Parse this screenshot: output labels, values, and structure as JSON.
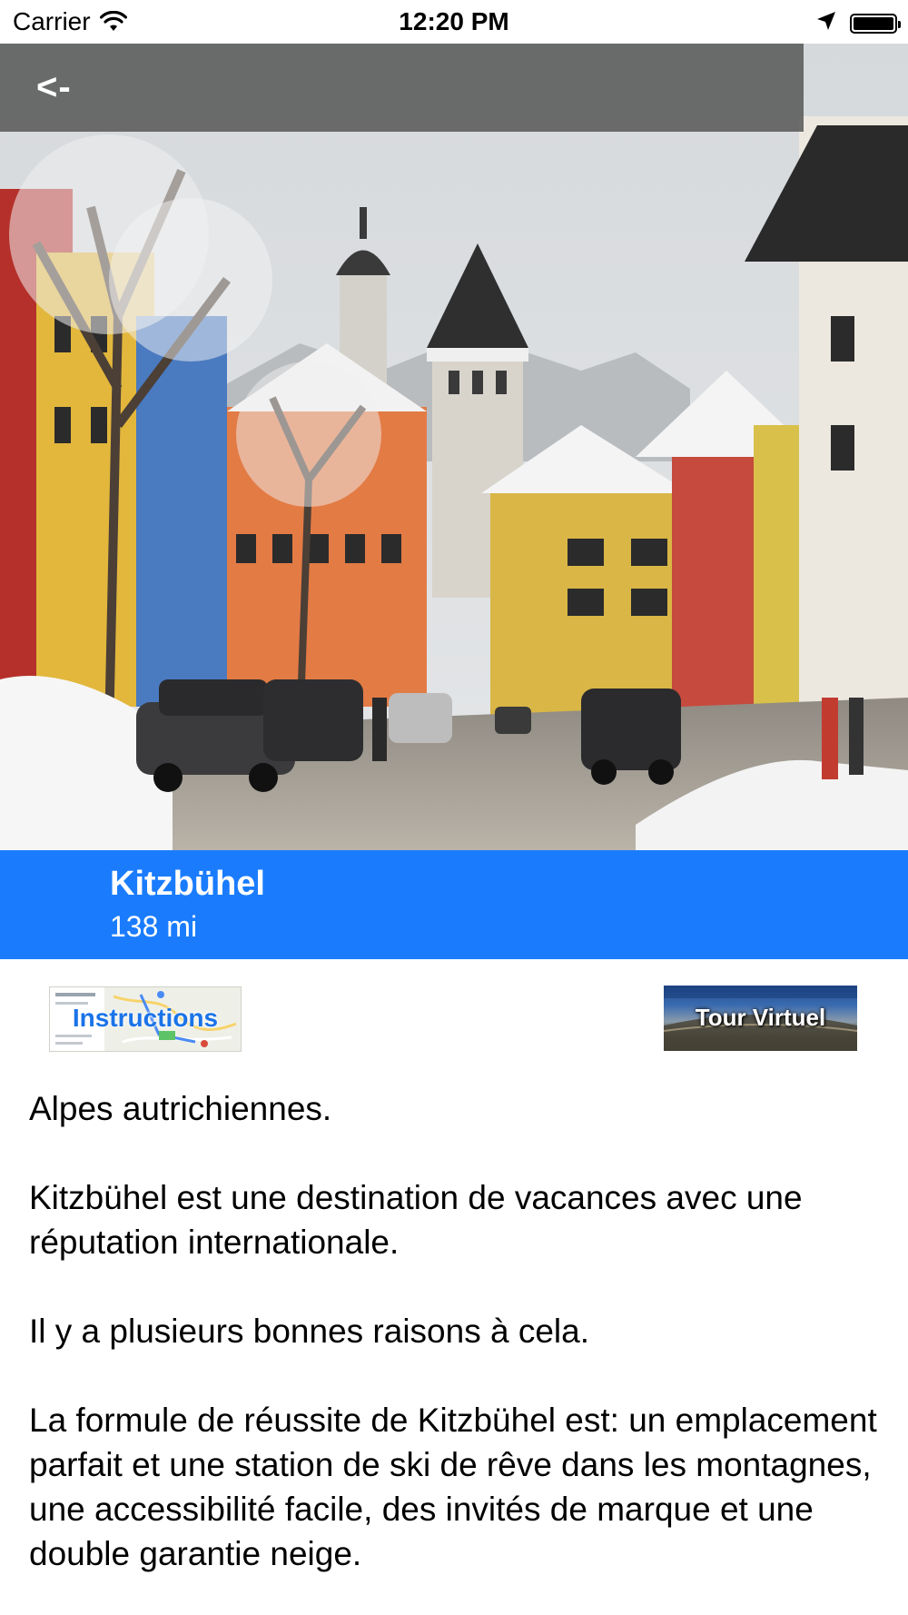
{
  "status_bar": {
    "carrier": "Carrier",
    "time": "12:20 PM",
    "icons": [
      "wifi-icon",
      "location-arrow-icon",
      "battery-icon"
    ]
  },
  "nav": {
    "back_label": "<-"
  },
  "hero": {
    "image": "snowy-alpine-town-street-photo"
  },
  "place": {
    "name": "Kitzbühel",
    "distance": "138 mi"
  },
  "buttons": {
    "instructions_label": "Instructions",
    "tour_label": "Tour Virtuel"
  },
  "description": {
    "paragraphs": [
      "Alpes autrichiennes.",
      "Kitzbühel est une destination de vacances avec une réputation internationale.",
      "Il y a plusieurs bonnes raisons à cela.",
      "La formule de réussite de Kitzbühel est: un emplacement parfait et une station de ski de rêve dans les montagnes, une accessibilité facile, des invités de marque et une double garantie neige."
    ]
  },
  "colors": {
    "banner": "#1a7cfd",
    "nav_overlay": "#5a5a5a",
    "text": "#000000"
  }
}
